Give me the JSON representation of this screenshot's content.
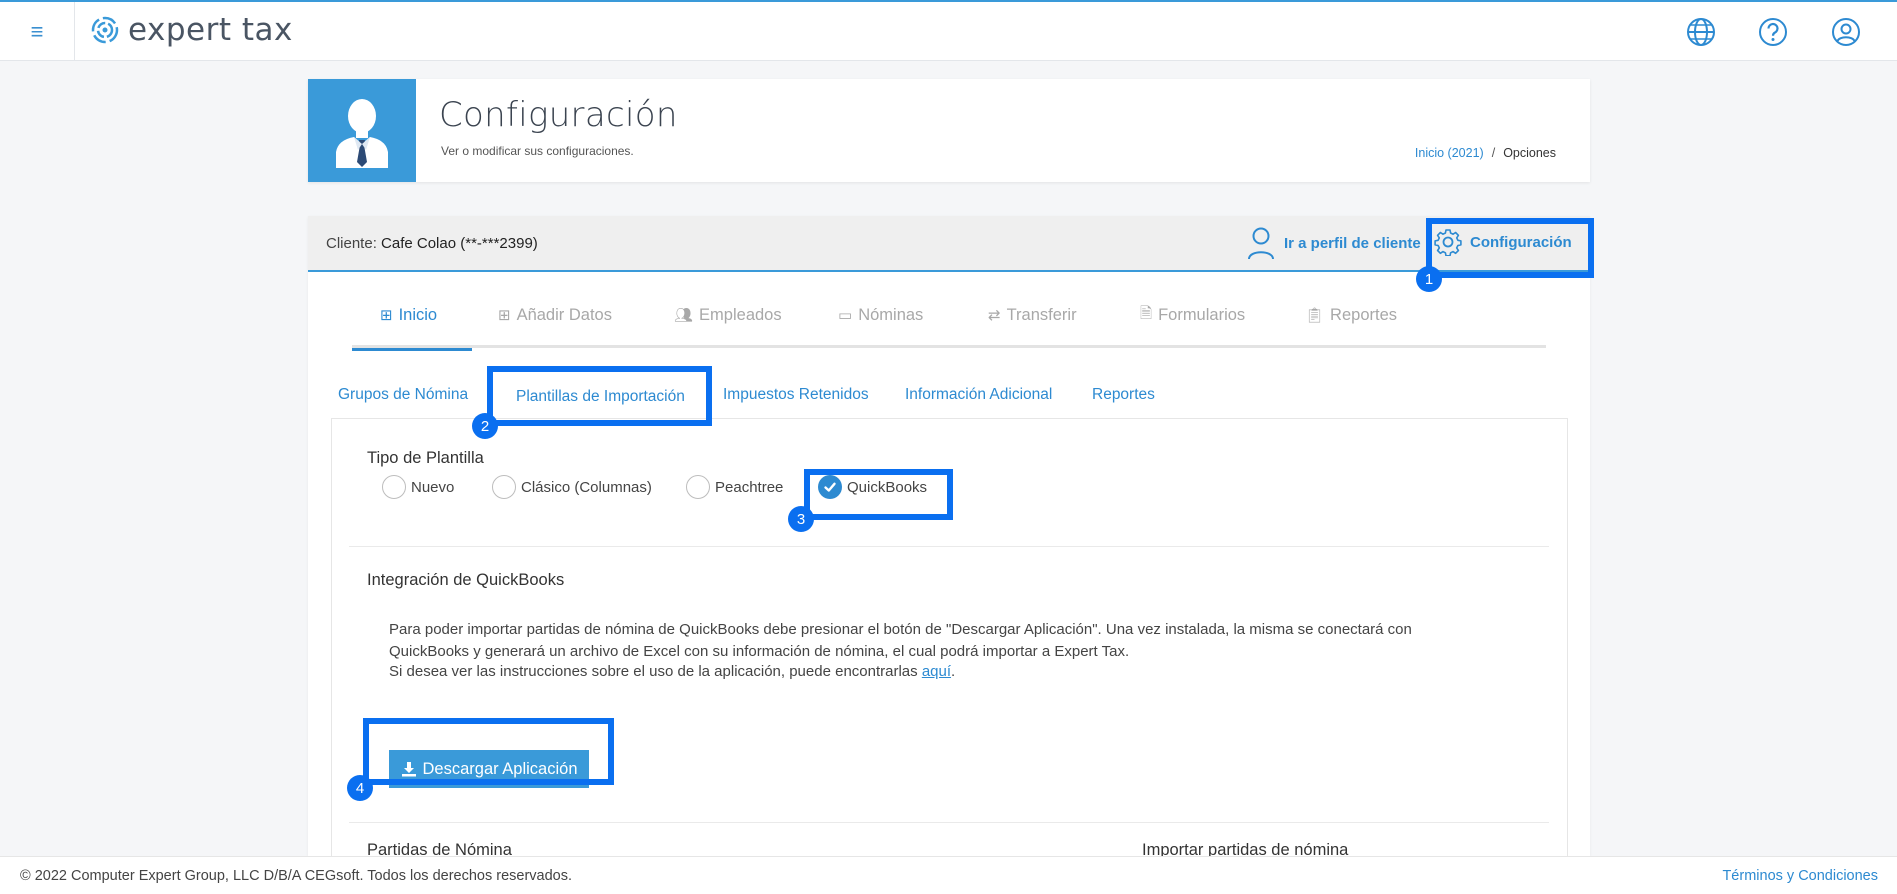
{
  "app": {
    "logo_text": "expert tax",
    "menu_icon": "hamburger-menu-icon",
    "top_icons": [
      "globe-icon",
      "help-circle-icon",
      "user-circle-icon"
    ]
  },
  "header": {
    "title": "Configuración",
    "subtitle": "Ver o modificar sus configuraciones.",
    "breadcrumb": {
      "home": "Inicio (2021)",
      "separator": "/",
      "current": "Opciones"
    }
  },
  "client": {
    "label": "Cliente:",
    "name": "Cafe Colao (**-***2399)",
    "profile_link": "Ir a perfil de cliente",
    "settings_link": "Configuración"
  },
  "tabs": [
    {
      "label": "Inicio",
      "icon": "table-icon"
    },
    {
      "label": "Añadir Datos",
      "icon": "plus-square-icon"
    },
    {
      "label": "Empleados",
      "icon": "users-icon"
    },
    {
      "label": "Nóminas",
      "icon": "money-bill-icon"
    },
    {
      "label": "Transferir",
      "icon": "exchange-icon"
    },
    {
      "label": "Formularios",
      "icon": "file-icon"
    },
    {
      "label": "Reportes",
      "icon": "clipboard-icon"
    }
  ],
  "subtabs": [
    "Grupos de Nómina",
    "Plantillas de Importación",
    "Impuestos Retenidos",
    "Información Adicional",
    "Reportes"
  ],
  "template": {
    "heading": "Tipo de Plantilla",
    "options": [
      "Nuevo",
      "Clásico (Columnas)",
      "Peachtree",
      "QuickBooks"
    ],
    "selected": "QuickBooks"
  },
  "integration": {
    "heading": "Integración de QuickBooks",
    "paragraph1": "Para poder importar partidas de nómina de QuickBooks debe presionar el botón de \"Descargar Aplicación\". Una vez instalada, la misma se conectará con QuickBooks y generará un archivo de Excel con su información de nómina, el cual podrá importar a Expert Tax.",
    "paragraph2_prefix": "Si desea ver las instrucciones sobre el uso de la aplicación, puede encontrarlas ",
    "paragraph2_link": "aquí",
    "paragraph2_suffix": ".",
    "download_button": "Descargar Aplicación"
  },
  "sections": {
    "left": "Partidas de Nómina",
    "right": "Importar partidas de nómina"
  },
  "callouts": [
    "1",
    "2",
    "3",
    "4"
  ],
  "colors": {
    "accent": "#3a9ad9",
    "callout": "#0a6ff0"
  },
  "footer": {
    "copyright": "© 2022 Computer Expert Group, LLC D/B/A CEGsoft. Todos los derechos reservados.",
    "terms": "Términos y Condiciones"
  }
}
